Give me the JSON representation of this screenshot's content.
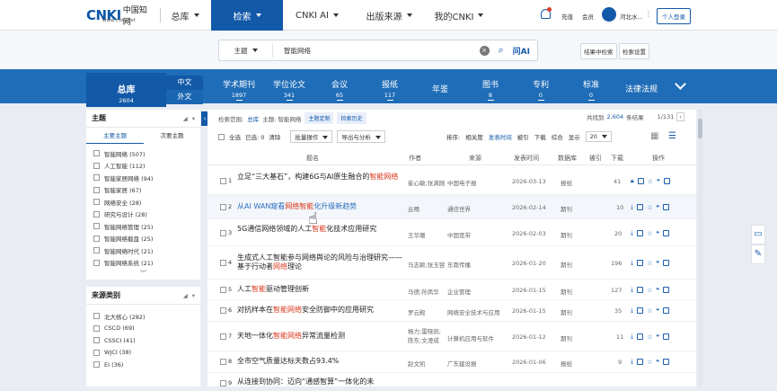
{
  "brand": {
    "logo_text": "CNKI",
    "logo_cn": "中国知网",
    "logo_url": "www.cnki.net"
  },
  "topnav": {
    "zongku": "总库",
    "items": [
      "检索",
      "CNKI AI",
      "出版来源",
      "我的CNKI"
    ],
    "util": [
      "充值",
      "会员"
    ],
    "org": "河北水...",
    "login": "个人登录"
  },
  "search": {
    "field": "主题",
    "value": "智能网络",
    "ai_label": "问AI",
    "in_result": "结果中检索",
    "settings": "检索设置"
  },
  "catbar": {
    "zongku_label": "总库",
    "zongku_count": "2604",
    "lang": [
      "中文",
      "外文"
    ],
    "items": [
      {
        "label": "学术期刊",
        "count": "1897"
      },
      {
        "label": "学位论文",
        "count": "341"
      },
      {
        "label": "会议",
        "count": "65"
      },
      {
        "label": "报纸",
        "count": "117"
      },
      {
        "label": "年鉴",
        "count": ""
      },
      {
        "label": "图书",
        "count": "8"
      },
      {
        "label": "专利",
        "count": "0"
      },
      {
        "label": "标准",
        "count": "0"
      },
      {
        "label": "法律法规",
        "count": ""
      }
    ]
  },
  "leftpanel": {
    "topic_title": "主题",
    "tabs": [
      "主要主题",
      "次要主题"
    ],
    "topics": [
      "智能网络 (507)",
      "人工智能 (112)",
      "智能家居网络 (94)",
      "智能家居 (67)",
      "网络安全 (28)",
      "研究与设计 (28)",
      "智能网络管理 (25)",
      "智能网络截盘 (25)",
      "智能网络时代 (21)",
      "智能网络系统 (21)"
    ],
    "source_title": "来源类别",
    "sources": [
      "北大核心 (282)",
      "CSCD (69)",
      "CSSCI (41)",
      "WJCI (38)",
      "EI (36)"
    ]
  },
  "main": {
    "scope_label": "检索范围:",
    "scope_value": "总库",
    "query_label": "主题: 智能网络",
    "tag_custom": "主题定制",
    "tag_history": "检索历史",
    "total_label": "共找到",
    "total_count": "2,604",
    "total_suffix": "条结果",
    "page": "1/131",
    "select_all": "全选",
    "selected": "已选: 0",
    "clear": "清除",
    "batch": "批量操作",
    "export": "导出与分析",
    "sort_label": "排序:",
    "sort_opts": [
      "相关度",
      "发表时间",
      "被引",
      "下载",
      "综合"
    ],
    "show_label": "显示",
    "show_value": "20",
    "headers": [
      "题名",
      "作者",
      "来源",
      "发表时间",
      "数据库",
      "被引",
      "下载",
      "操作"
    ],
    "rows": [
      {
        "no": "1",
        "title_parts": [
          "立足“三大基石”，构建6G与AI原生融合的",
          "智能网络",
          ""
        ],
        "author": "崔心敏;张满刚",
        "source": "中国电子报",
        "date": "2026-03-13",
        "db": "报纸",
        "cite": "",
        "dl": "41"
      },
      {
        "no": "2",
        "title_parts": [
          "从AI WAN窥看",
          "网络智能",
          "化升级新趋势"
        ],
        "author": "云晴",
        "source": "通信世界",
        "date": "2026-02-14",
        "db": "期刊",
        "cite": "",
        "dl": "10"
      },
      {
        "no": "3",
        "title_parts": [
          "5G通信网络领域的人工",
          "智能",
          "化技术应用研究"
        ],
        "author": "王华珊",
        "source": "中国宽带",
        "date": "2026-02-03",
        "db": "期刊",
        "cite": "",
        "dl": "20"
      },
      {
        "no": "4",
        "title_parts": [
          "生成式人工智能参与网络舆论的风险与治理研究——基于行动者",
          "网络",
          "理论"
        ],
        "author": "马志赖;张玉容",
        "source": "东南传播",
        "date": "2026-01-20",
        "db": "期刊",
        "cite": "",
        "dl": "196"
      },
      {
        "no": "5",
        "title_parts": [
          "人工",
          "智能",
          "驱动管理创新"
        ],
        "author": "马德;孙凤华",
        "source": "企业管理",
        "date": "2026-01-15",
        "db": "期刊",
        "cite": "",
        "dl": "127"
      },
      {
        "no": "6",
        "title_parts": [
          "对抗样本在",
          "智能网络",
          "安全防御中的应用研究"
        ],
        "author": "罗云殿",
        "source": "网络安全技术与应用",
        "date": "2026-01-15",
        "db": "期刊",
        "cite": "",
        "dl": "35"
      },
      {
        "no": "7",
        "title_parts": [
          "天地一体化",
          "智能网络",
          "异常流量检测"
        ],
        "author": "杨力;雷晓凯;陈东;文澄成",
        "source": "计算机应用与软件",
        "date": "2026-01-12",
        "db": "期刊",
        "cite": "",
        "dl": "11"
      },
      {
        "no": "8",
        "title_parts": [
          "全市空气质量达标天数占93.4%",
          "",
          ""
        ],
        "author": "赵文凯",
        "source": "广东建设报",
        "date": "2026-01-06",
        "db": "报纸",
        "cite": "",
        "dl": "9"
      },
      {
        "no": "9",
        "title_parts": [
          "从连接到协同：迈向“通感智算”一体化的未",
          "",
          ""
        ],
        "author": "",
        "source": "",
        "date": "",
        "db": "",
        "cite": "",
        "dl": ""
      }
    ]
  }
}
